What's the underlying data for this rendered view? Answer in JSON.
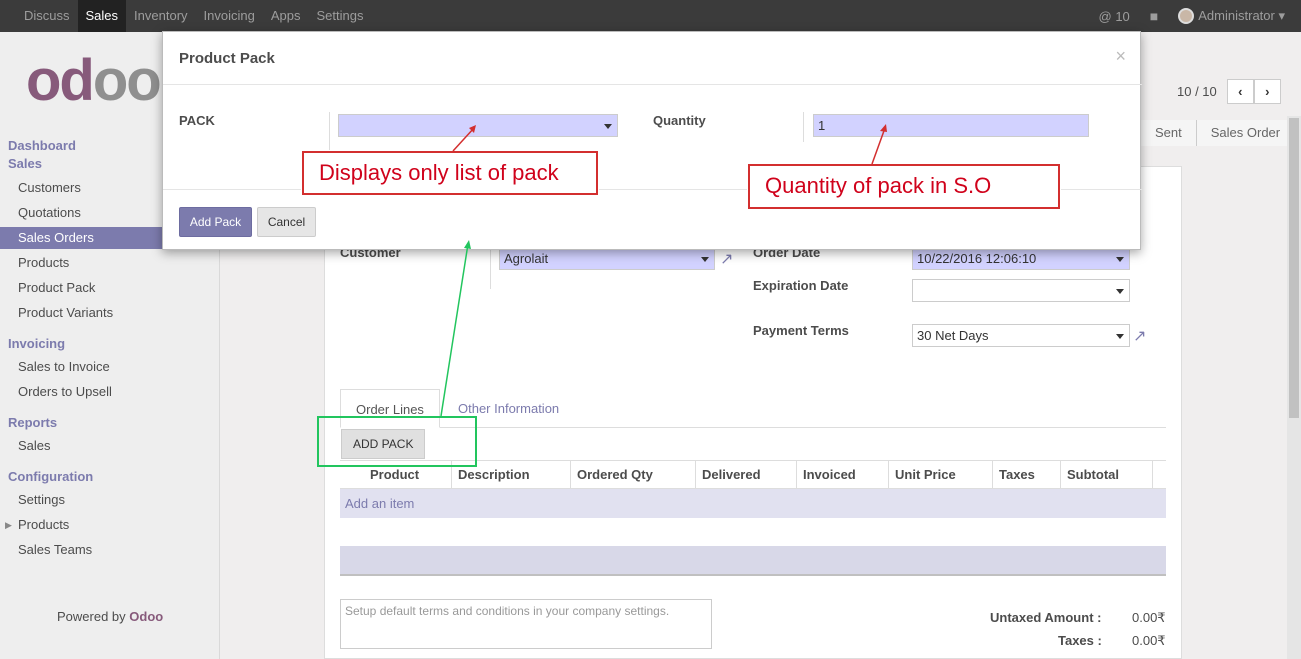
{
  "topbar": {
    "menu": [
      "Discuss",
      "Sales",
      "Inventory",
      "Invoicing",
      "Apps",
      "Settings"
    ],
    "active": "Sales",
    "notifications": "@ 10",
    "user": "Administrator"
  },
  "sidebar": {
    "logo": [
      "od",
      "oo"
    ],
    "sections": [
      {
        "title": "Dashboard",
        "items": []
      },
      {
        "title": "Sales",
        "items": [
          "Customers",
          "Quotations",
          "Sales Orders",
          "Products",
          "Product Pack",
          "Product Variants"
        ]
      },
      {
        "title": "Invoicing",
        "items": [
          "Sales to Invoice",
          "Orders to Upsell"
        ]
      },
      {
        "title": "Reports",
        "items": [
          "Sales"
        ]
      },
      {
        "title": "Configuration",
        "items": [
          "Settings",
          "Products",
          "Sales Teams"
        ]
      }
    ],
    "active_item": "Sales Orders",
    "powered_prefix": "Powered by ",
    "powered_brand": "Odoo"
  },
  "pager": {
    "value": "10 / 10",
    "prev": "‹",
    "next": "›"
  },
  "statusbar": [
    "Sent",
    "Sales Order"
  ],
  "form": {
    "customer_label": "Customer",
    "customer_value": "Agrolait",
    "order_date_label": "Order Date",
    "order_date_value": "10/22/2016 12:06:10",
    "expiration_label": "Expiration Date",
    "expiration_value": "",
    "payment_terms_label": "Payment Terms",
    "payment_terms_value": "30 Net Days",
    "tabs": [
      "Order Lines",
      "Other Information"
    ],
    "add_pack_button": "ADD PACK",
    "columns": [
      "Product",
      "Description",
      "Ordered Qty",
      "Delivered",
      "Invoiced",
      "Unit Price",
      "Taxes",
      "Subtotal"
    ],
    "add_item": "Add an item",
    "terms_placeholder": "Setup default terms and conditions in your company settings.",
    "untaxed_label": "Untaxed Amount :",
    "untaxed_value": "0.00₹",
    "taxes_label": "Taxes :",
    "taxes_value": "0.00₹"
  },
  "modal": {
    "title": "Product Pack",
    "close": "×",
    "pack_label": "PACK",
    "pack_value": "",
    "quantity_label": "Quantity",
    "quantity_value": "1",
    "add_button": "Add Pack",
    "cancel_button": "Cancel"
  },
  "annotations": {
    "pack_note": "Displays only list of pack",
    "quantity_note": "Quantity of pack in S.O"
  },
  "colors": {
    "accent": "#7c7bad",
    "brand": "#875a7b",
    "annotation_red": "#d0021b",
    "annotation_green": "#22c55e"
  }
}
